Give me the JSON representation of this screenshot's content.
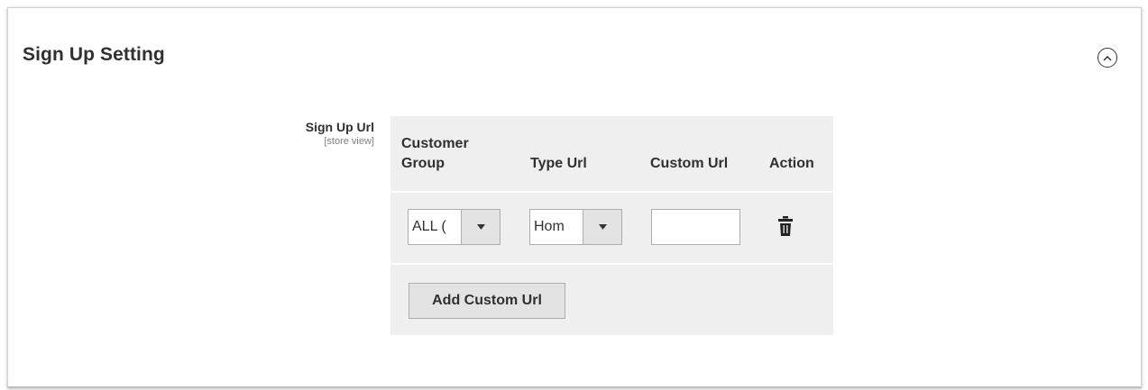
{
  "section": {
    "title": "Sign Up Setting",
    "collapse_icon": "chevron-up-circle-icon"
  },
  "field": {
    "label": "Sign Up Url",
    "scope": "[store view]"
  },
  "grid": {
    "headers": {
      "customer_group": "Customer Group",
      "type_url": "Type Url",
      "custom_url": "Custom Url",
      "action": "Action"
    },
    "rows": [
      {
        "customer_group": "ALL (",
        "type_url": "Hom",
        "custom_url": "",
        "action_icon": "trash-icon"
      }
    ],
    "add_button": "Add Custom Url"
  },
  "colors": {
    "grid_bg": "#efefef",
    "button_bg": "#e3e3e3",
    "border": "#adadad",
    "text": "#303030"
  }
}
